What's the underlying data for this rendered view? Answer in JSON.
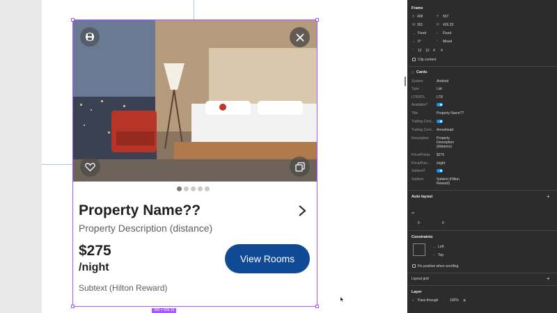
{
  "card": {
    "title": "Property Name??",
    "description": "Property Description (distance)",
    "price": "$275",
    "per_night": "/night",
    "view_rooms_label": "View Rooms",
    "subtext": "Subtext (Hilton Reward)",
    "image_count": 5,
    "active_image": 1,
    "frame_size": "350 × 426.33"
  },
  "colors": {
    "accent": "#104a96",
    "selection": "#a259ff",
    "panel_bg": "#2c2c2c",
    "toggle_on": "#0d99ff"
  },
  "icons": {
    "logo": "hilton-logo-icon",
    "close": "close-icon",
    "favorite": "heart-icon",
    "gallery": "gallery-icon",
    "chevron": "chevron-right-icon"
  },
  "panel": {
    "frame": {
      "title": "Frame",
      "x_label": "X",
      "x_value": "408",
      "y_label": "Y",
      "y_value": "507",
      "w_label": "W",
      "w_value": "361",
      "h_label": "H",
      "h_value": "426.33",
      "w_mode": "Fixed",
      "h_mode": "Fixed",
      "rotation": "0°",
      "radius_mode": "Mixed",
      "corner_1": "12",
      "corner_2": "12",
      "corner_3": "4",
      "corner_4": "4",
      "clip_label": "Clip content"
    },
    "component": {
      "title": "Cards",
      "props": [
        {
          "label": "System",
          "value": "Android"
        },
        {
          "label": "Type",
          "value": "List"
        },
        {
          "label": "LTR/RTL",
          "value": "LTR"
        },
        {
          "label": "Available?",
          "value": ""
        },
        {
          "label": "Title",
          "value": "Property Name??"
        },
        {
          "label": "Trailing Cont...",
          "value": ""
        },
        {
          "label": "Trailing Cont...",
          "value": "Arrowhead"
        },
        {
          "label": "Description",
          "value": "Property"
        },
        {
          "label": "Price/Points",
          "value": "$275"
        },
        {
          "label": "Price/Poin...",
          "value": "/night"
        },
        {
          "label": "Subtext?",
          "value": ""
        },
        {
          "label": "Subtext",
          "value": "Subtext (Hilton"
        }
      ],
      "description_line2": "Description",
      "description_line3": "(distance)",
      "subtext_line2": "Reward)"
    },
    "auto_layout": {
      "title": "Auto layout",
      "gap_value": "0",
      "padding_value": "0"
    },
    "constraints": {
      "title": "Constraints",
      "horizontal": "Left",
      "vertical": "Top",
      "fix_label": "Fix position when scrolling"
    },
    "layout_grid": {
      "title": "Layout grid"
    },
    "layer": {
      "title": "Layer",
      "blend": "Pass through",
      "opacity": "100%"
    }
  }
}
